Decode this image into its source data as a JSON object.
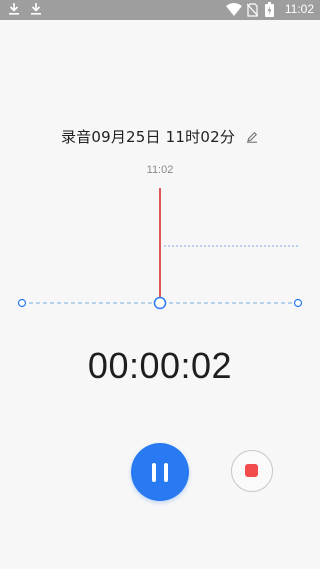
{
  "status_bar": {
    "time": "11:02",
    "icons_left": [
      "download-icon",
      "download-icon"
    ],
    "icons_right": [
      "wifi-icon",
      "no-sim-icon",
      "battery-icon"
    ]
  },
  "recording": {
    "title": "录音09月25日 11时02分",
    "edit_icon": "pencil-icon",
    "time_marker": "11:02",
    "elapsed": "00:00:02"
  },
  "controls": {
    "pause_icon": "pause-icon",
    "stop_icon": "stop-icon"
  },
  "colors": {
    "accent": "#2979f2",
    "playhead": "#e05555",
    "baseline": "#7aaee6",
    "stop": "#f24b4b",
    "status_bar": "#9e9e9e"
  }
}
